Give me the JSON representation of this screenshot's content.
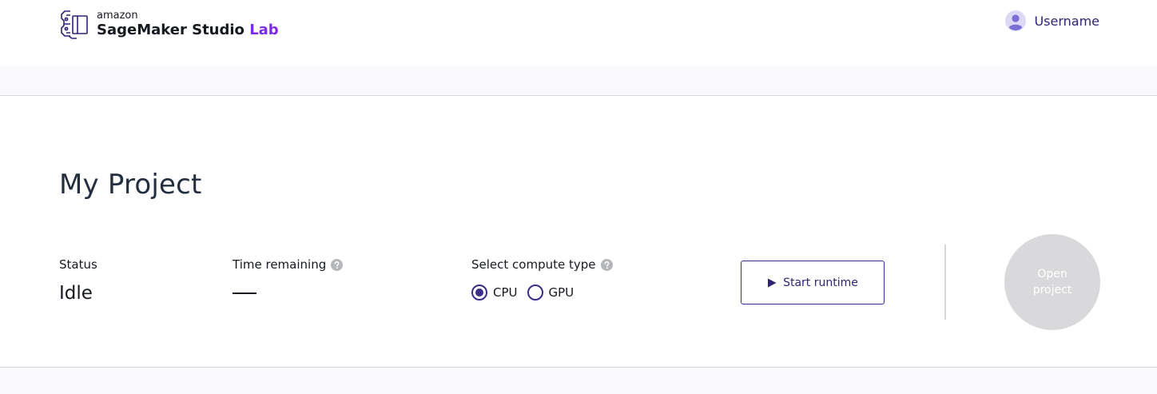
{
  "header": {
    "brand_line1": "amazon",
    "brand_product": "SageMaker Studio",
    "brand_product_accent": "Lab",
    "brand_accent_color": "#7d2ae8",
    "user": {
      "avatar_icon": "user-avatar-icon",
      "name": "Username"
    }
  },
  "project": {
    "title": "My Project",
    "status": {
      "label": "Status",
      "value": "Idle"
    },
    "time_remaining": {
      "label": "Time remaining",
      "value": "—",
      "help_icon": "help-icon"
    },
    "compute": {
      "label": "Select compute type",
      "help_icon": "help-icon",
      "options": [
        {
          "label": "CPU",
          "selected": true
        },
        {
          "label": "GPU",
          "selected": false
        }
      ]
    },
    "start_button": {
      "label": "Start runtime",
      "icon": "play-icon"
    },
    "open_button": {
      "line1": "Open",
      "line2": "project",
      "disabled": true
    }
  },
  "colors": {
    "primary": "#2e2473",
    "accent": "#7d2ae8",
    "band": "#f8f8fd",
    "disabled": "#d9d9db"
  }
}
